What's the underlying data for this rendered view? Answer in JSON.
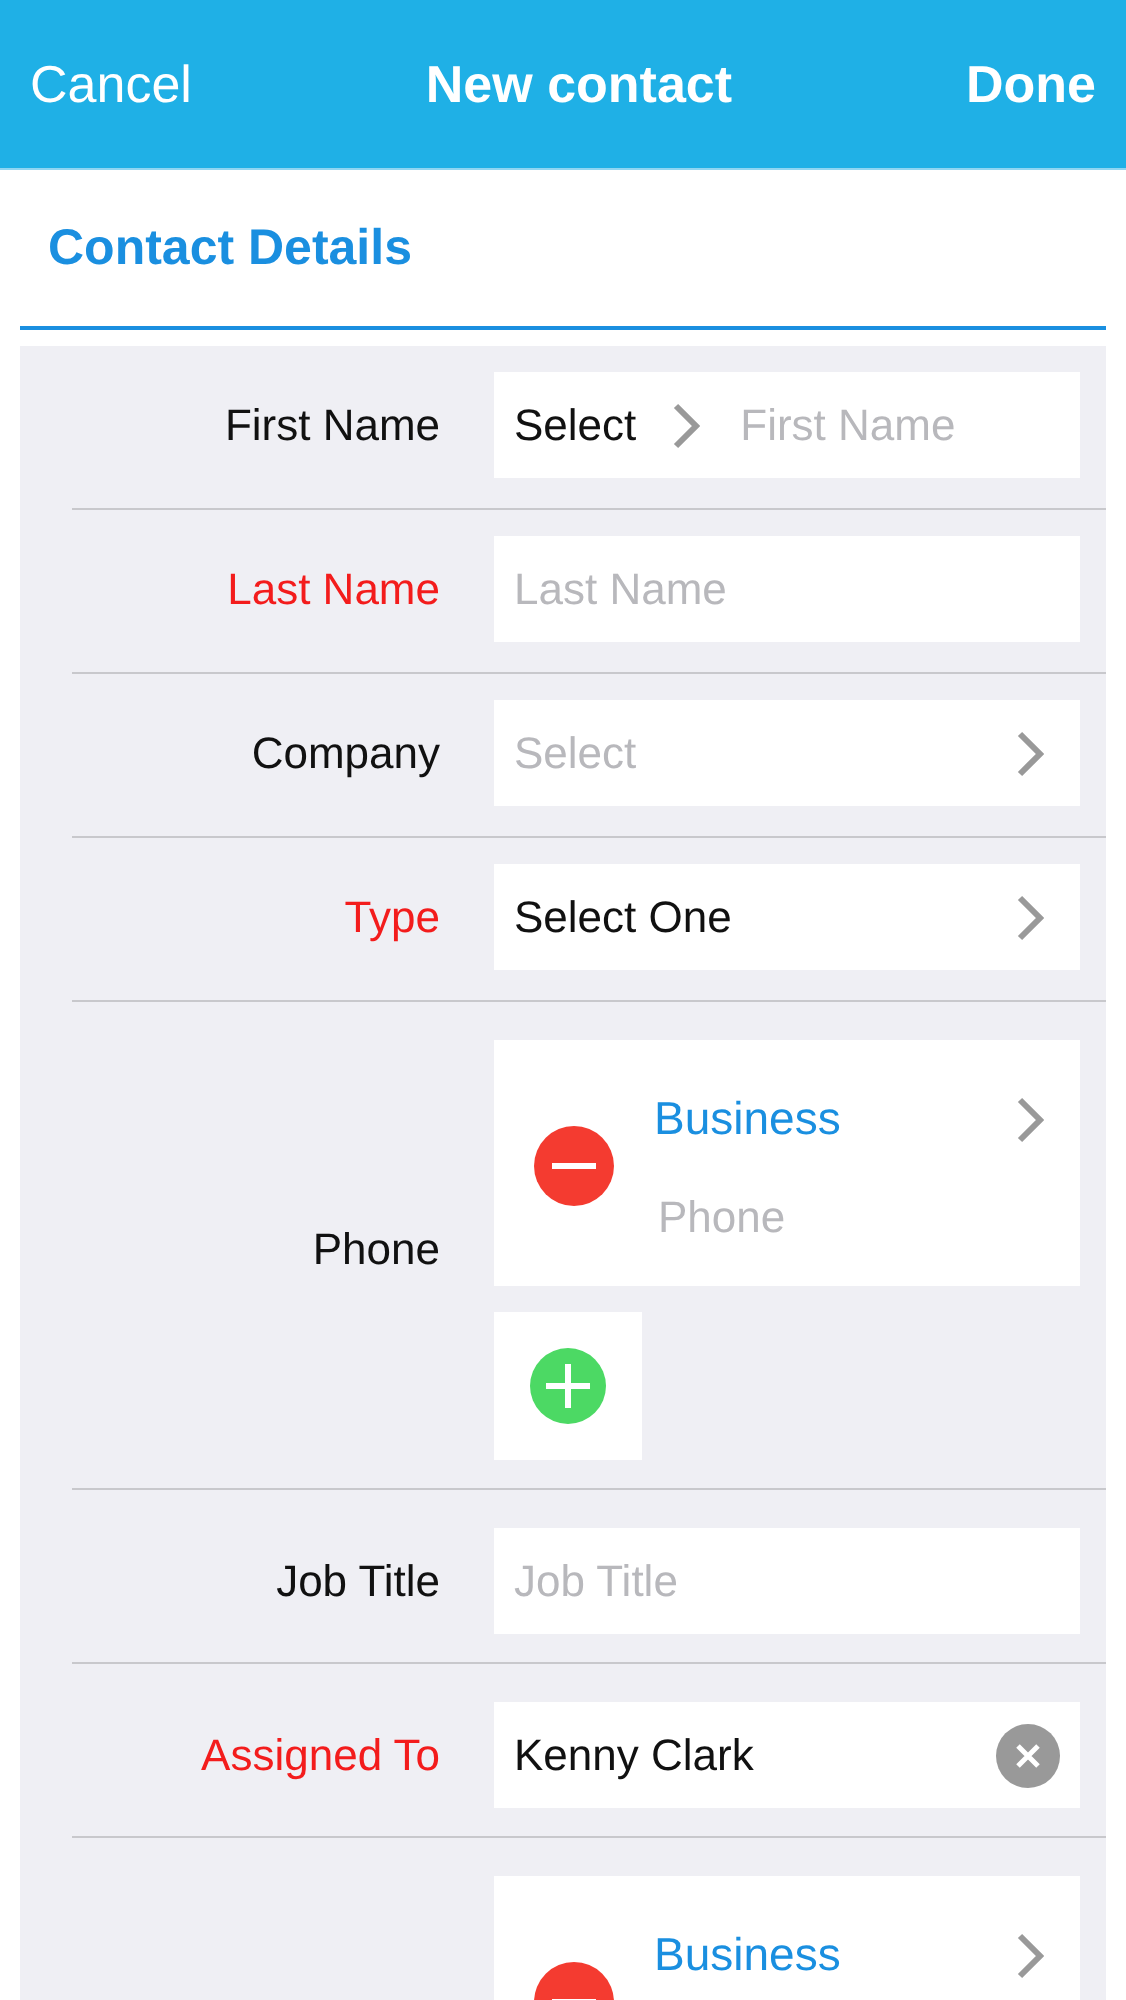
{
  "nav_bar": {
    "left_button": "Cancel",
    "title": "New contact",
    "right_button": "Done"
  },
  "section": {
    "title": "Contact Details"
  },
  "rows": [
    {
      "label": "First Name",
      "required": false,
      "kind": "select_input",
      "select": "Select",
      "placeholder": "First Name"
    },
    {
      "label": "Last Name",
      "required": true,
      "kind": "input",
      "placeholder": "Last Name"
    },
    {
      "label": "Company",
      "required": false,
      "kind": "select",
      "placeholder": "Select"
    },
    {
      "label": "Type",
      "required": true,
      "kind": "select",
      "value": "Select One"
    },
    {
      "label": "Phone",
      "required": false,
      "kind": "multi",
      "entries": [
        {
          "type": "Business",
          "placeholder": "Phone"
        }
      ],
      "addable": true
    },
    {
      "label": "Job Title",
      "required": false,
      "kind": "input",
      "placeholder": "Job Title"
    },
    {
      "label": "Assigned To",
      "required": true,
      "kind": "clearable",
      "value": "Kenny Clark"
    },
    {
      "kind": "multi",
      "entries": [
        {
          "type": "Business"
        }
      ]
    }
  ]
}
